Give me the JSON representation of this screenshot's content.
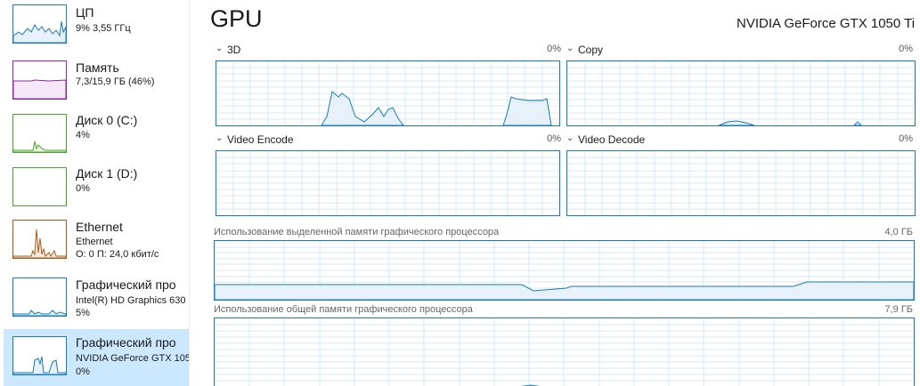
{
  "sidebar": {
    "items": [
      {
        "title": "ЦП",
        "sub1": "9% 3,55 ГГц",
        "sub2": "",
        "color": "#1a7ab5",
        "selected": false
      },
      {
        "title": "Память",
        "sub1": "7,3/15,9 ГБ (46%)",
        "sub2": "",
        "color": "#8b2a9a",
        "selected": false
      },
      {
        "title": "Диск 0 (C:)",
        "sub1": "4%",
        "sub2": "",
        "color": "#4da033",
        "selected": false
      },
      {
        "title": "Диск 1 (D:)",
        "sub1": "0%",
        "sub2": "",
        "color": "#4da033",
        "selected": false
      },
      {
        "title": "Ethernet",
        "sub1": "Ethernet",
        "sub2": "О: 0 П: 24,0 кбит/с",
        "color": "#a75b1a",
        "selected": false
      },
      {
        "title": "Графический про",
        "sub1": "Intel(R) HD Graphics 630",
        "sub2": "5%",
        "color": "#1a7ab5",
        "selected": false
      },
      {
        "title": "Графический про",
        "sub1": "NVIDIA GeForce GTX 105",
        "sub2": "0%",
        "color": "#1a7ab5",
        "selected": true
      }
    ]
  },
  "main": {
    "title": "GPU",
    "device": "NVIDIA GeForce GTX 1050 Ti",
    "engines": [
      {
        "label": "3D",
        "percent": "0%"
      },
      {
        "label": "Copy",
        "percent": "0%"
      },
      {
        "label": "Video Encode",
        "percent": "0%"
      },
      {
        "label": "Video Decode",
        "percent": "0%"
      }
    ],
    "dedicated_memory": {
      "label": "Использование выделенной памяти графического процессора",
      "max": "4,0 ГБ"
    },
    "shared_memory": {
      "label": "Использование общей памяти графического процессора",
      "max": "7,9 ГБ"
    }
  },
  "colors": {
    "gpu": "#1a7ab5",
    "gpu_fill": "#e6f1fa",
    "grid": "#d6e8f4",
    "selection": "#cce8ff"
  }
}
